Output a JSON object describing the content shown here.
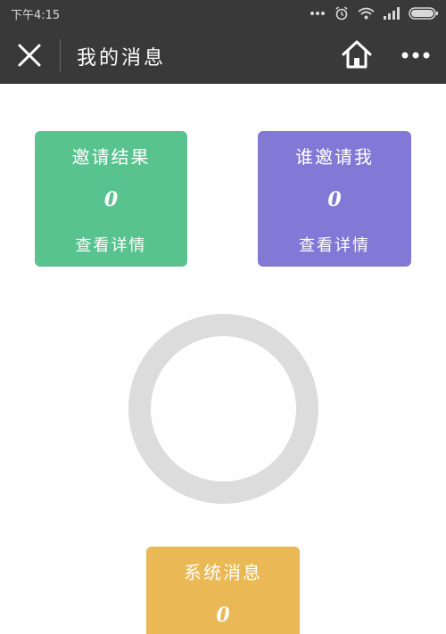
{
  "status_bar": {
    "time": "下午4:15"
  },
  "nav": {
    "title": "我的消息",
    "close_icon": "close-icon",
    "home_icon": "home-icon",
    "more_icon": "more-icon"
  },
  "cards": {
    "invite_results": {
      "title": "邀请结果",
      "count": "0",
      "link": "查看详情",
      "color": "#59c38f"
    },
    "who_invited": {
      "title": "谁邀请我",
      "count": "0",
      "link": "查看详情",
      "color": "#8278d6"
    },
    "system": {
      "title": "系统消息",
      "count": "0",
      "color": "#ebb856"
    }
  },
  "colors": {
    "nav_background": "#393939",
    "ring": "#dcdcdc"
  }
}
